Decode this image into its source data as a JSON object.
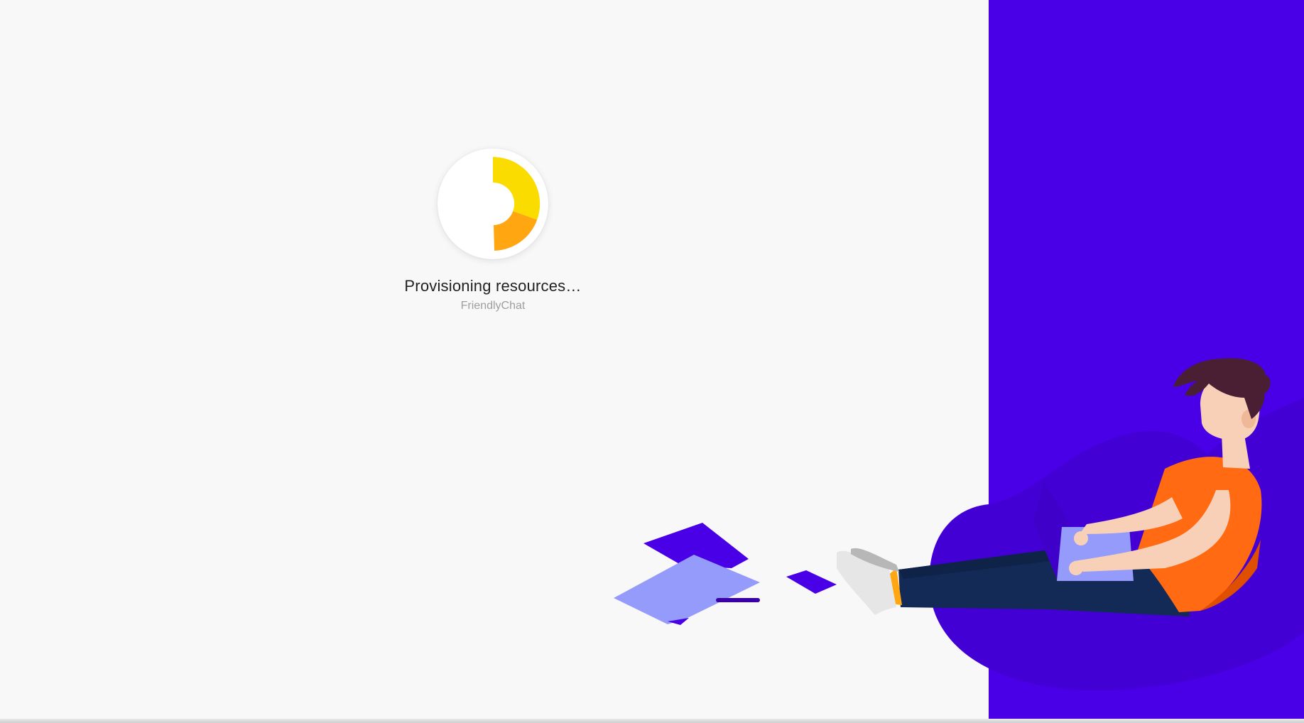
{
  "status": {
    "title": "Provisioning resources…",
    "project_name": "FriendlyChat"
  },
  "loader": {
    "icon": "spinner-icon",
    "colors": {
      "primary": "#fbdc00",
      "secondary": "#ffa611"
    }
  },
  "theme": {
    "background": "#f8f8f8",
    "panel": "#4a00e6"
  },
  "illustration": {
    "icon": "person-with-laptop-illustration"
  }
}
